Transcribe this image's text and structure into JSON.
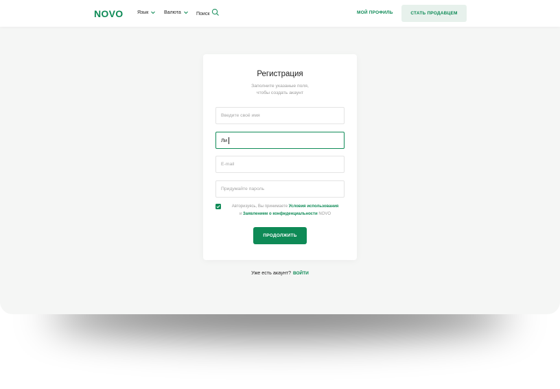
{
  "header": {
    "logo": "NOVO",
    "language_label": "Язык",
    "currency_label": "Валюта",
    "search_label": "Поиск",
    "profile_link": "МОЙ ПРОФИЛЬ",
    "seller_button": "СТАТЬ ПРОДАВЦЕМ"
  },
  "form": {
    "title": "Регистрация",
    "subtitle_line1": "Заполните указаные поля,",
    "subtitle_line2": "чтобы создать акаунт",
    "name_placeholder": "Введите своё имя",
    "lastname_value": "Ли",
    "email_placeholder": "E-mail",
    "password_placeholder": "Придумайте пароль",
    "agree_prefix": "Авторизуясь, Вы принимаете",
    "terms_link": "Условия использования",
    "agree_and": "и",
    "privacy_link": "Заявлением о конфиденциальности",
    "agree_suffix": "NOVO",
    "agree_checked": true,
    "continue_button": "ПРОДОЛЖИТЬ"
  },
  "footer": {
    "have_account": "Уже есть акаунт?",
    "login_link": "ВОЙТИ"
  },
  "colors": {
    "accent": "#0e8a56",
    "accent_light": "#e7f1ec",
    "background": "#f5f6f5"
  },
  "icons": {
    "language_dropdown": "chevron-down-icon",
    "currency_dropdown": "chevron-down-icon",
    "search": "search-icon",
    "checkbox": "check-icon"
  }
}
